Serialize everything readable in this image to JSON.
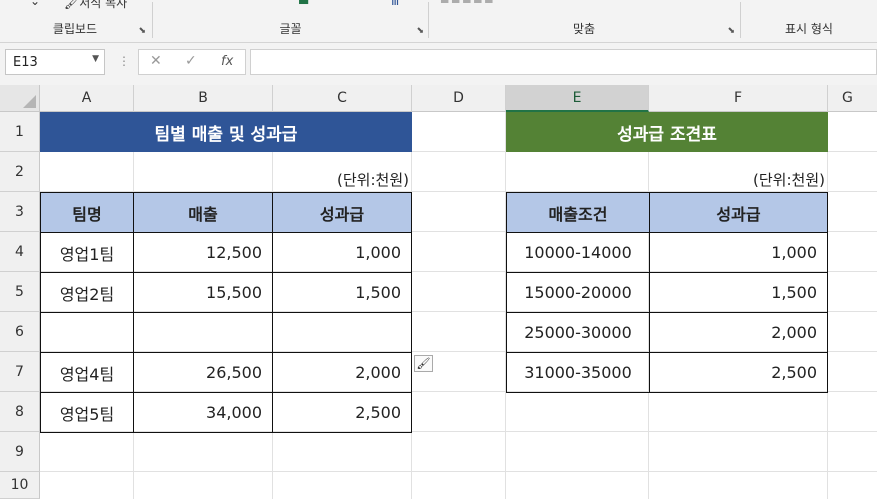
{
  "ribbon": {
    "clipboard": {
      "label": "클립보드",
      "format_painter": "서식 복사"
    },
    "font": {
      "label": "글꼴"
    },
    "alignment": {
      "label": "맞춤"
    },
    "number": {
      "label": "표시 형식"
    }
  },
  "formula_bar": {
    "name_box": "E13",
    "fx": "fx",
    "formula": ""
  },
  "columns": [
    "A",
    "B",
    "C",
    "D",
    "E",
    "F",
    "G"
  ],
  "rows": [
    "1",
    "2",
    "3",
    "4",
    "5",
    "6",
    "7",
    "8",
    "9",
    "10"
  ],
  "team_table": {
    "title": "팀별 매출 및 성과급",
    "unit": "(단위:천원)",
    "headers": [
      "팀명",
      "매출",
      "성과급"
    ],
    "rows": [
      [
        "영업1팀",
        "12,500",
        "1,000"
      ],
      [
        "영업2팀",
        "15,500",
        "1,500"
      ],
      [
        "",
        "",
        ""
      ],
      [
        "영업4팀",
        "26,500",
        "2,000"
      ],
      [
        "영업5팀",
        "34,000",
        "2,500"
      ]
    ]
  },
  "bonus_table": {
    "title": "성과급 조견표",
    "unit": "(단위:천원)",
    "headers": [
      "매출조건",
      "성과급"
    ],
    "rows": [
      [
        "10000-14000",
        "1,000"
      ],
      [
        "15000-20000",
        "1,500"
      ],
      [
        "25000-30000",
        "2,000"
      ],
      [
        "31000-35000",
        "2,500"
      ]
    ]
  },
  "colors": {
    "team_title_bg": "#2f5597",
    "bonus_title_bg": "#548235",
    "header_bg": "#b4c7e7",
    "selected_col_accent": "#217346"
  }
}
